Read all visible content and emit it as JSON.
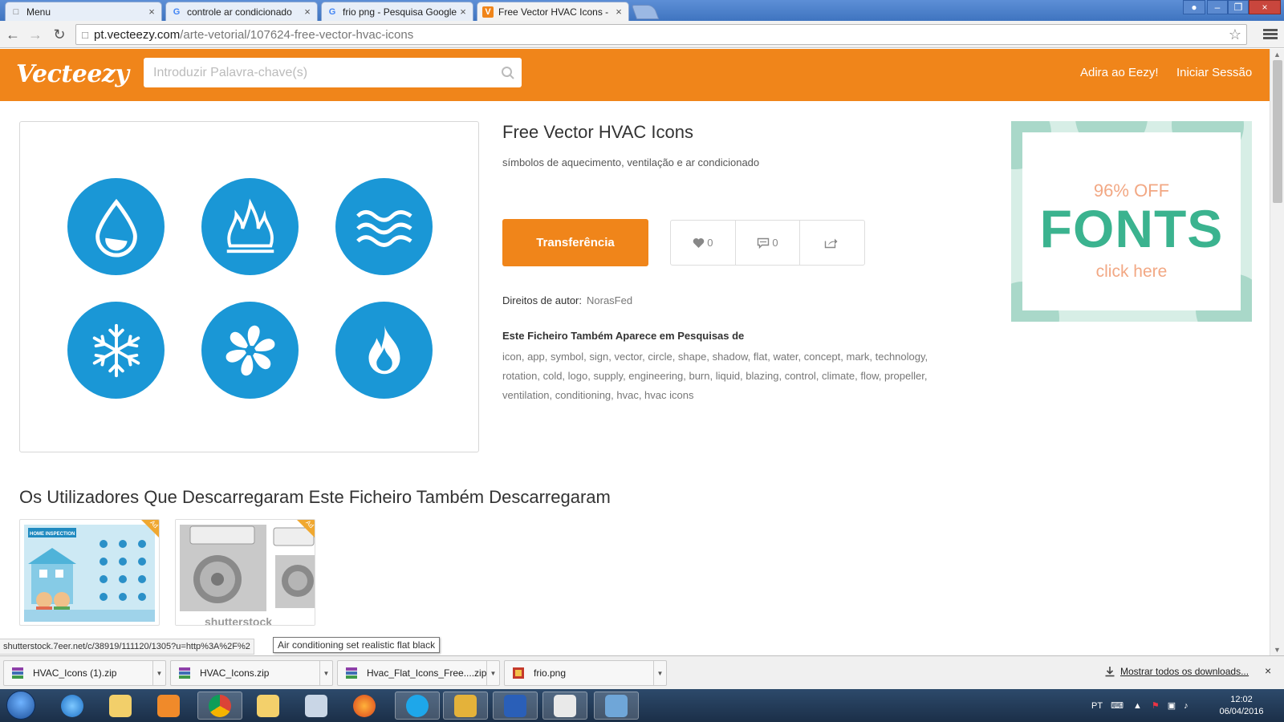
{
  "browser": {
    "tabs": [
      {
        "title": "Menu",
        "icon": "page-icon",
        "active": false
      },
      {
        "title": "controle ar condicionado",
        "icon": "google-icon",
        "active": false
      },
      {
        "title": "frio png - Pesquisa Google",
        "icon": "google-icon",
        "active": false
      },
      {
        "title": "Free Vector HVAC Icons -",
        "icon": "vecteezy-icon",
        "active": true
      }
    ],
    "url_host": "pt.vecteezy.com",
    "url_path": "/arte-vetorial/107624-free-vector-hvac-icons"
  },
  "header": {
    "logo": "Vecteezy",
    "search_placeholder": "Introduzir Palavra-chave(s)",
    "join_label": "Adira ao Eezy!",
    "login_label": "Iniciar Sessão",
    "accent": "#f0851a"
  },
  "preview": {
    "icon_color": "#1a97d6",
    "icons": [
      "water-drop-icon",
      "flame-icon",
      "air-waves-icon",
      "snowflake-icon",
      "fan-icon",
      "fire-icon"
    ]
  },
  "asset": {
    "title": "Free Vector HVAC Icons",
    "description": "símbolos de aquecimento, ventilação e ar condicionado",
    "download_label": "Transferência",
    "likes": "0",
    "comments": "0",
    "copyright_label": "Direitos de autor:",
    "author": "NorasFed",
    "tags_heading": "Este Ficheiro Também Aparece em Pesquisas de",
    "tags_text": "icon, app, symbol, sign, vector, circle, shape, shadow, flat, water, concept, mark, technology, rotation, cold, logo, supply, engineering, burn, liquid, blazing, control, climate, flow, propeller, ventilation, conditioning, hvac, hvac icons"
  },
  "ad": {
    "discount": "96% OFF",
    "headline": "FONTS",
    "cta": "click here"
  },
  "related": {
    "title": "Os Utilizadores Que Descarregaram Este Ficheiro Também Descarregaram",
    "ad_badge": "Ad",
    "thumb1_banner": "HOME INSPECTION",
    "thumb2_watermark": "shutterstock"
  },
  "status": {
    "url": "shutterstock.7eer.net/c/38919/111120/1305?u=http%3A%2F%2",
    "tooltip": "Air conditioning set realistic flat black"
  },
  "downloads": {
    "items": [
      "HVAC_Icons (1).zip",
      "HVAC_Icons.zip",
      "Hvac_Flat_Icons_Free....zip",
      "frio.png"
    ],
    "show_all": "Mostrar todos os downloads..."
  },
  "taskbar": {
    "lang": "PT",
    "time": "12:02",
    "date": "06/04/2016"
  }
}
